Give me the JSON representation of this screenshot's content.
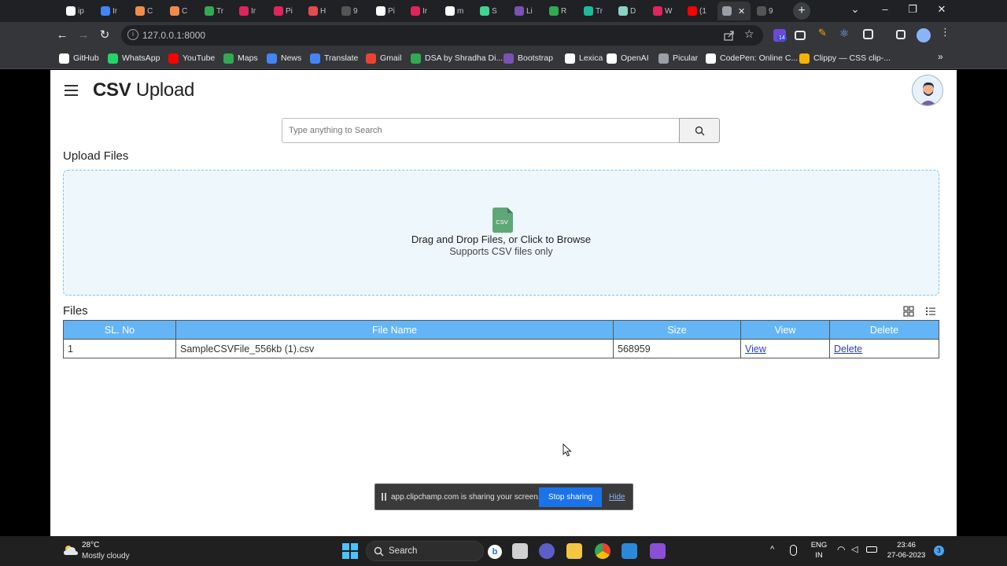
{
  "browser": {
    "tabs": [
      {
        "label": "ip",
        "color": "#ffffff"
      },
      {
        "label": "Ir",
        "color": "#4285f4"
      },
      {
        "label": "C",
        "color": "#f28b4c"
      },
      {
        "label": "C",
        "color": "#f28b4c"
      },
      {
        "label": "Tr",
        "color": "#34a853"
      },
      {
        "label": "Ir",
        "color": "#e0245e"
      },
      {
        "label": "Pi",
        "color": "#e0245e"
      },
      {
        "label": "H",
        "color": "#e34c4c"
      },
      {
        "label": "9",
        "color": "#555555"
      },
      {
        "label": "Pi",
        "color": "#ffffff"
      },
      {
        "label": "Ir",
        "color": "#e0245e"
      },
      {
        "label": "m",
        "color": "#ffffff"
      },
      {
        "label": "S",
        "color": "#42d392"
      },
      {
        "label": "Li",
        "color": "#7952b3"
      },
      {
        "label": "R",
        "color": "#34a853"
      },
      {
        "label": "Tr",
        "color": "#1abc9c"
      },
      {
        "label": "D",
        "color": "#8ad3c6"
      },
      {
        "label": "W",
        "color": "#e0245e"
      },
      {
        "label": "(1",
        "color": "#ff0000"
      },
      {
        "label": "",
        "color": "#9aa0a6"
      },
      {
        "label": "9",
        "color": "#555555"
      }
    ],
    "url": "127.0.0.1:8000",
    "extension_badge": "14",
    "bookmarks": [
      {
        "label": "GitHub",
        "color": "#ffffff"
      },
      {
        "label": "WhatsApp",
        "color": "#25d366"
      },
      {
        "label": "YouTube",
        "color": "#ff0000"
      },
      {
        "label": "Maps",
        "color": "#34a853"
      },
      {
        "label": "News",
        "color": "#4285f4"
      },
      {
        "label": "Translate",
        "color": "#4285f4"
      },
      {
        "label": "Gmail",
        "color": "#ea4335"
      },
      {
        "label": "DSA by Shradha Di...",
        "color": "#34a853"
      },
      {
        "label": "Bootstrap",
        "color": "#7952b3"
      },
      {
        "label": "Lexica",
        "color": "#ffffff"
      },
      {
        "label": "OpenAI",
        "color": "#ffffff"
      },
      {
        "label": "Picular",
        "color": "#9aa0a6"
      },
      {
        "label": "CodePen: Online C...",
        "color": "#ffffff"
      },
      {
        "label": "Clippy — CSS clip-...",
        "color": "#f4b400"
      }
    ],
    "bookmarks_more": "»"
  },
  "app": {
    "title_bold": "CSV",
    "title_rest": " Upload",
    "search_placeholder": "Type anything to Search",
    "upload_heading": "Upload Files",
    "dropzone": {
      "icon_label": "CSV",
      "main_text": "Drag and Drop Files, or Click to Browse",
      "sub_text": "Supports CSV files only"
    },
    "files_heading": "Files",
    "table": {
      "headers": [
        "SL. No",
        "File Name",
        "Size",
        "View",
        "Delete"
      ],
      "rows": [
        {
          "sl": "1",
          "name": "SampleCSVFile_556kb (1).csv",
          "size": "568959",
          "view": "View",
          "delete": "Delete"
        }
      ]
    }
  },
  "share_bar": {
    "message": "app.clipchamp.com is sharing your screen.",
    "stop_label": "Stop sharing",
    "hide_label": "Hide"
  },
  "taskbar": {
    "weather_temp": "28°C",
    "weather_desc": "Mostly cloudy",
    "search_label": "Search",
    "lang_1": "ENG",
    "lang_2": "IN",
    "time": "23:46",
    "date": "27-06-2023",
    "notification_count": "3"
  }
}
